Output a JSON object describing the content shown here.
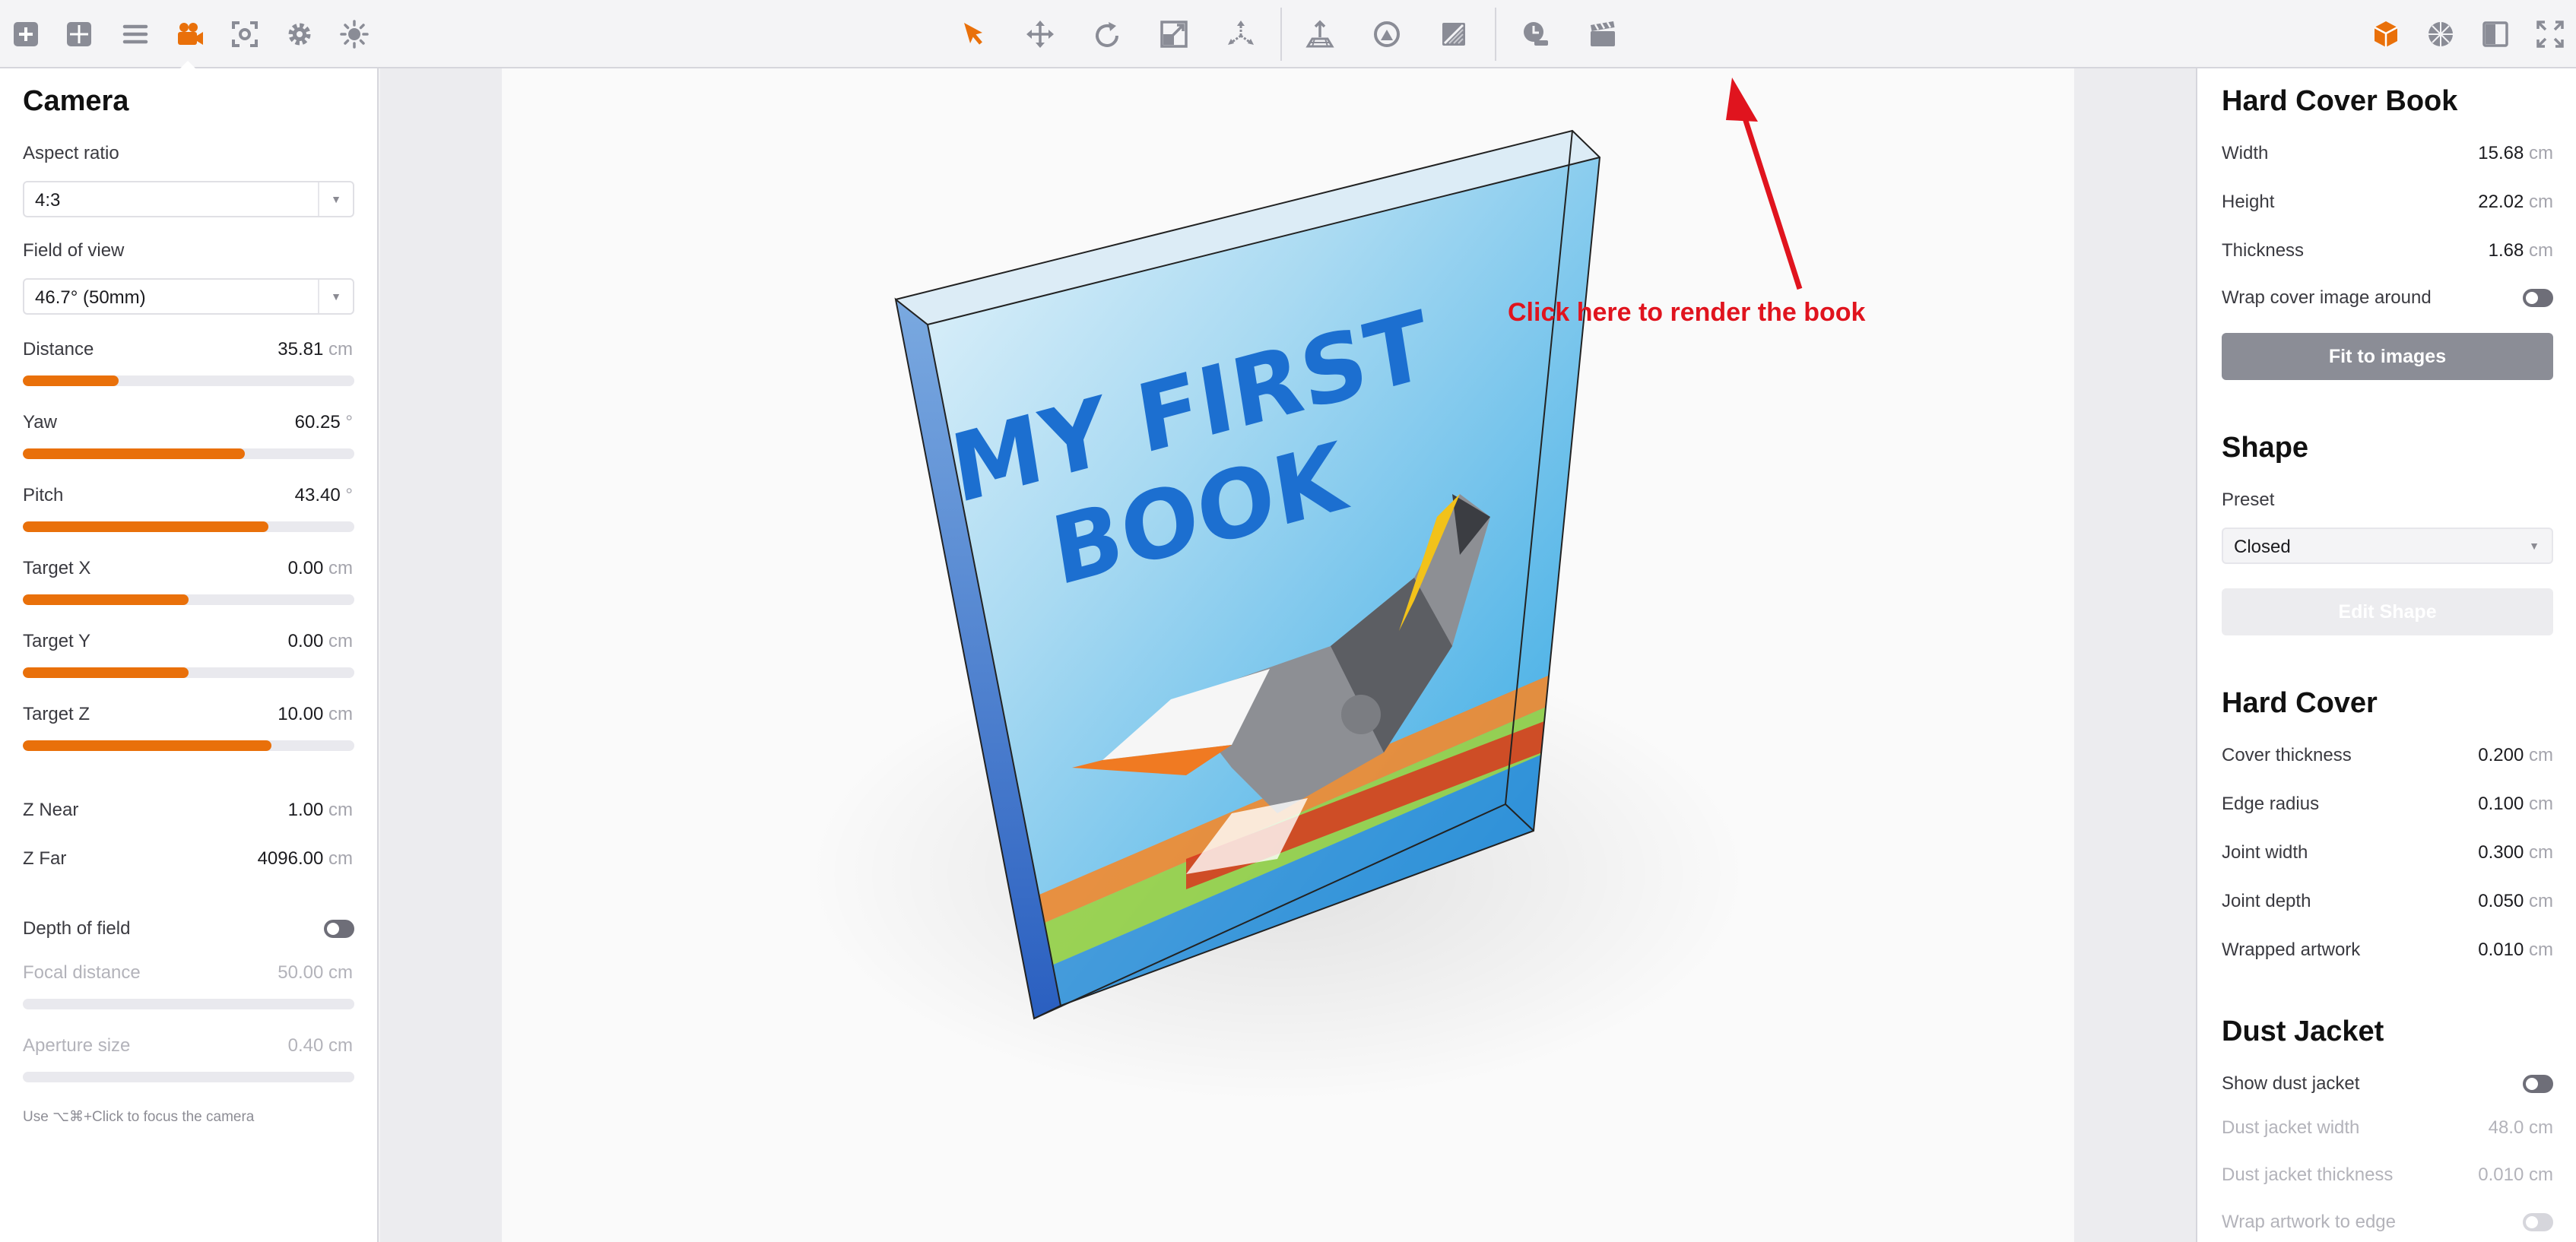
{
  "toolbar": {
    "left_tools": [
      "add-icon",
      "grid-icon",
      "list-icon",
      "camera-icon",
      "focus-icon",
      "gear-icon",
      "light-icon"
    ],
    "center_tools": [
      "select-arrow-icon",
      "move-icon",
      "rotate-icon",
      "scale-icon",
      "axes-icon",
      "floor-icon",
      "env-icon",
      "material-icon",
      "timer-icon",
      "render-clapper-icon"
    ],
    "right_tools": [
      "cube-icon",
      "texture-icon",
      "layout-icon",
      "fullscreen-icon"
    ],
    "accent_color": "#e9700a"
  },
  "camera": {
    "title": "Camera",
    "aspect_ratio": {
      "label": "Aspect ratio",
      "value": "4:3"
    },
    "field_of_view": {
      "label": "Field of view",
      "value": "46.7° (50mm)"
    },
    "sliders": [
      {
        "label": "Distance",
        "value": "35.81",
        "unit": "cm",
        "fill": 0.29
      },
      {
        "label": "Yaw",
        "value": "60.25",
        "unit": "°",
        "fill": 0.67
      },
      {
        "label": "Pitch",
        "value": "43.40",
        "unit": "°",
        "fill": 0.74
      },
      {
        "label": "Target X",
        "value": "0.00",
        "unit": "cm",
        "fill": 0.5
      },
      {
        "label": "Target Y",
        "value": "0.00",
        "unit": "cm",
        "fill": 0.5
      },
      {
        "label": "Target Z",
        "value": "10.00",
        "unit": "cm",
        "fill": 0.75
      }
    ],
    "z_near": {
      "label": "Z Near",
      "value": "1.00",
      "unit": "cm"
    },
    "z_far": {
      "label": "Z Far",
      "value": "4096.00",
      "unit": "cm"
    },
    "depth_of_field": {
      "label": "Depth of field"
    },
    "focal_distance": {
      "label": "Focal distance",
      "value": "50.00",
      "unit": "cm"
    },
    "aperture_size": {
      "label": "Aperture size",
      "value": "0.40",
      "unit": "cm"
    },
    "hint": "Use ⌥⌘+Click to focus the camera"
  },
  "viewport": {
    "book_title_line1": "MY FIRST",
    "book_title_line2": "BOOK",
    "annotation": "Click here to render the book"
  },
  "hard_cover_book": {
    "title": "Hard Cover Book",
    "width": {
      "label": "Width",
      "value": "15.68",
      "unit": "cm"
    },
    "height": {
      "label": "Height",
      "value": "22.02",
      "unit": "cm"
    },
    "thickness": {
      "label": "Thickness",
      "value": "1.68",
      "unit": "cm"
    },
    "wrap_cover": {
      "label": "Wrap cover image around"
    },
    "fit_button": "Fit to images"
  },
  "shape": {
    "title": "Shape",
    "preset_label": "Preset",
    "preset_value": "Closed",
    "edit_button": "Edit Shape"
  },
  "hard_cover": {
    "title": "Hard Cover",
    "rows": [
      {
        "label": "Cover thickness",
        "value": "0.200",
        "unit": "cm"
      },
      {
        "label": "Edge radius",
        "value": "0.100",
        "unit": "cm"
      },
      {
        "label": "Joint width",
        "value": "0.300",
        "unit": "cm"
      },
      {
        "label": "Joint depth",
        "value": "0.050",
        "unit": "cm"
      },
      {
        "label": "Wrapped artwork",
        "value": "0.010",
        "unit": "cm"
      }
    ]
  },
  "dust_jacket": {
    "title": "Dust Jacket",
    "show_label": "Show dust jacket",
    "width": {
      "label": "Dust jacket width",
      "value": "48.0",
      "unit": "cm"
    },
    "thickness": {
      "label": "Dust jacket thickness",
      "value": "0.010",
      "unit": "cm"
    },
    "wrap_label": "Wrap artwork to edge"
  }
}
